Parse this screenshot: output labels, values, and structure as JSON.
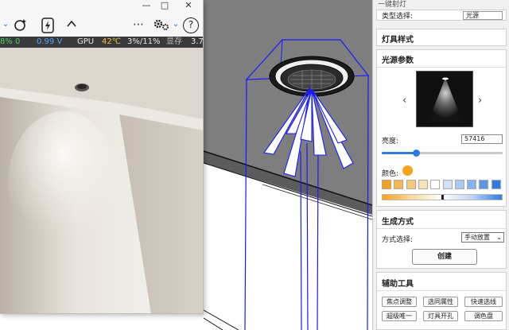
{
  "floating_window": {
    "titlebar": {
      "minimize": "—",
      "maximize": "□",
      "close": "✕"
    },
    "toolbar": {
      "chevron": "⌄",
      "more": "⋯",
      "help": "?"
    },
    "stats": {
      "cpu_fragment": "8% 0",
      "power": "0.99 V",
      "gpu_label": "GPU",
      "gpu_temp": "42℃",
      "gpu_usage": "3%/11%",
      "mem_label": "显存",
      "mem_value": "3.7"
    }
  },
  "panel": {
    "title": "一键射灯",
    "selector_label": "类型选择:",
    "selector_value": "光源",
    "style_section": "灯具样式",
    "light_section": "光源参数",
    "prev_arrow": "‹",
    "next_arrow": "›",
    "brightness_label": "亮度:",
    "brightness_value": "57416",
    "brightness_level": 0.28,
    "color_label": "颜色:",
    "current_color": "#f5a21a",
    "swatches": [
      "#f5a21a",
      "#f6b650",
      "#f8c87a",
      "#fbe1b8",
      "#ffffff",
      "#cfe0f7",
      "#a9c9f3",
      "#82b1ee",
      "#5c98e8",
      "#2f7be0"
    ],
    "gen_section": "生成方式",
    "mode_label": "方式选择:",
    "mode_value": "手动放置",
    "create_button": "创建",
    "aux_section": "辅助工具",
    "tools": [
      "焦点调整",
      "选同属性",
      "快速选线",
      "超级唯一",
      "灯具开孔",
      "调色盘"
    ]
  }
}
